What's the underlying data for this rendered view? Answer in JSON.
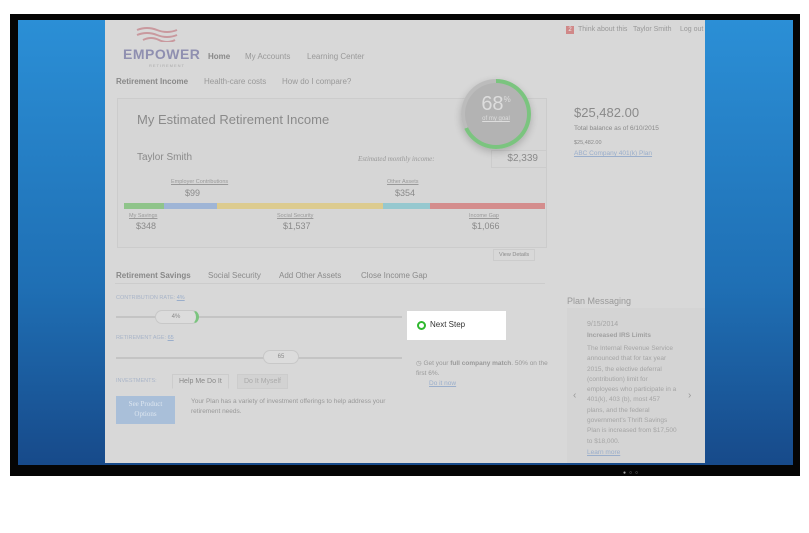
{
  "logo": {
    "name": "EMPOWER",
    "sub": "RETIREMENT"
  },
  "header": {
    "badge": "2",
    "think": "Think about this",
    "user": "Taylor Smith",
    "logout": "Log out"
  },
  "nav": [
    "Home",
    "My Accounts",
    "Learning Center"
  ],
  "subnav": [
    "Retirement Income",
    "Health-care costs",
    "How do I compare?"
  ],
  "card": {
    "title": "My Estimated Retirement Income",
    "name": "Taylor Smith",
    "est_label": "Estimated monthly income:",
    "est_value": "$2,339",
    "goal_pct": "68",
    "goal_pct_sign": "%",
    "goal_label": "of my goal",
    "top": [
      {
        "label": "Employer Contributions",
        "value": "$99"
      },
      {
        "label": "Other Assets",
        "value": "$354"
      }
    ],
    "bottom": [
      {
        "label": "My Savings",
        "value": "$348"
      },
      {
        "label": "Social Security",
        "value": "$1,537"
      },
      {
        "label": "Income Gap",
        "value": "$1,066"
      }
    ],
    "colors": {
      "savings": "#8fc48a",
      "employer": "#9fb5d6",
      "social": "#dccb8f",
      "other": "#96c8cf",
      "gap": "#d48d8d"
    },
    "view_details": "View Details"
  },
  "balance": {
    "amount": "$25,482.00",
    "as_of": "Total balance as of 6/10/2015",
    "plan_amount": "$25,482.00",
    "plan_name": "ABC Company 401(k) Plan"
  },
  "tabs": [
    "Retirement Savings",
    "Social Security",
    "Add Other Assets",
    "Close Income Gap"
  ],
  "contribution": {
    "label": "CONTRIBUTION RATE:",
    "value": "4%",
    "thumb": "4%"
  },
  "age": {
    "label": "RETIREMENT AGE:",
    "value": "65",
    "thumb": "65"
  },
  "investments": {
    "label": "INVESTMENTS:",
    "opt1": "Help Me Do It",
    "opt2": "Do It Myself",
    "button": "See Product Options",
    "text": "Your Plan has a variety of investment offerings to help address your retirement needs."
  },
  "next": {
    "title": "Next Step",
    "pre": "Get your ",
    "bold": "full company match",
    "post": ". 50% on the first 6%.",
    "link": "Do it now"
  },
  "plan_messaging": {
    "title": "Plan Messaging",
    "date": "9/15/2014",
    "headline": "Increased IRS Limits",
    "body": "The Internal Revenue Service announced that for tax year 2015, the elective deferral (contribution) limit for employees who participate in a 401(k), 403 (b), most 457 plans, and the federal government's Thrift Savings Plan is increased from $17,500 to $18,000.",
    "link": "Learn more",
    "prev": "‹",
    "next": "›"
  }
}
